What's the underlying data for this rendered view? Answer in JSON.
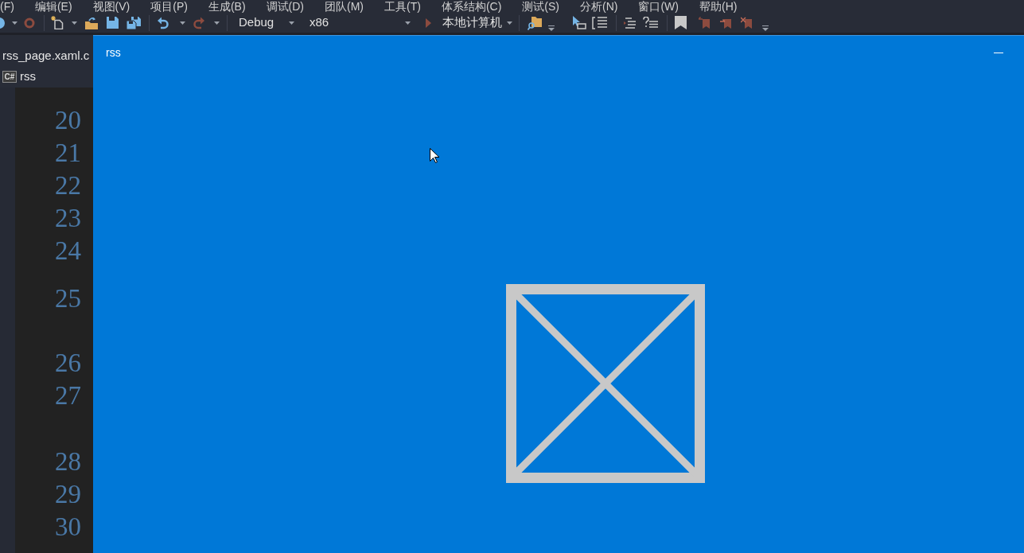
{
  "menu_bar": {
    "items": [
      "(F)",
      "编辑(E)",
      "视图(V)",
      "项目(P)",
      "生成(B)",
      "调试(D)",
      "团队(M)",
      "工具(T)",
      "体系结构(C)",
      "测试(S)",
      "分析(N)",
      "窗口(W)",
      "帮助(H)"
    ]
  },
  "toolbar": {
    "configuration": "Debug",
    "platform": "x86",
    "start_button": "本地计算机"
  },
  "editor": {
    "tab": "rss_page.xaml.c",
    "file_type_badge": "C#",
    "navigation": "rss",
    "line_numbers": [
      "20",
      "21",
      "22",
      "23",
      "24",
      "25",
      "26",
      "27",
      "28",
      "29",
      "30"
    ]
  },
  "app_window": {
    "title": "rss"
  }
}
